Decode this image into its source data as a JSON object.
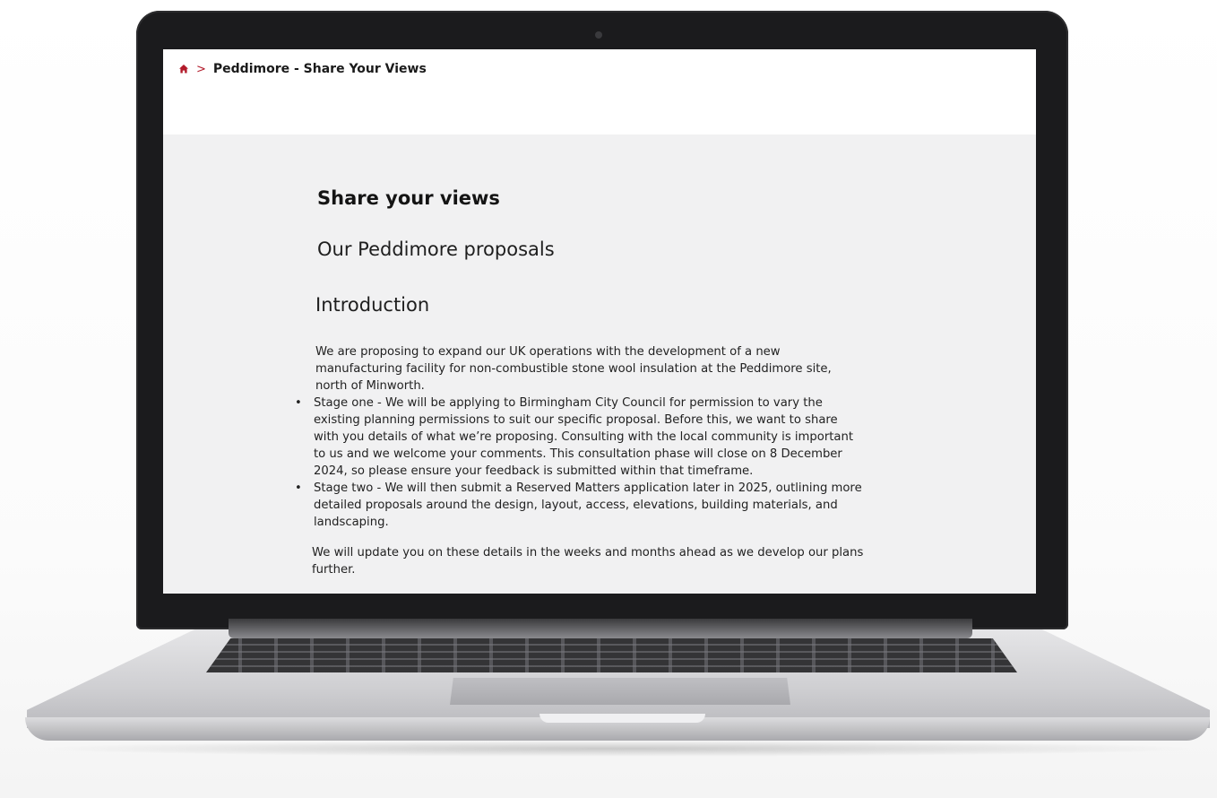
{
  "breadcrumb": {
    "separator": ">",
    "current": "Peddimore - Share Your Views"
  },
  "content": {
    "heading_share": "Share your views",
    "heading_proposals": "Our Peddimore proposals",
    "heading_intro": "Introduction",
    "intro_paragraph": "We are proposing to expand our UK operations with the development of a new manufacturing facility for non-combustible stone wool insulation at the Peddimore site, north of Minworth.",
    "stages": [
      "Stage one - We will be applying to Birmingham City Council for permission to vary the existing planning permissions to suit our specific proposal. Before this, we want to share with you details of what we’re proposing. Consulting with the local community is important to us and we welcome your comments. This consultation phase will close on 8 December 2024, so please ensure your feedback is submitted within that timeframe.",
      "Stage two - We will then submit a Reserved Matters application later in 2025, outlining more detailed proposals around the design, layout, access, elevations, building materials, and landscaping."
    ],
    "closing_paragraph": "We will update you on these details in the weeks and months ahead as we develop our plans further."
  },
  "icons": {
    "home": "home-icon"
  },
  "colors": {
    "brand_red": "#b21a2a",
    "page_background": "#f1f1f2",
    "header_background": "#ffffff"
  }
}
